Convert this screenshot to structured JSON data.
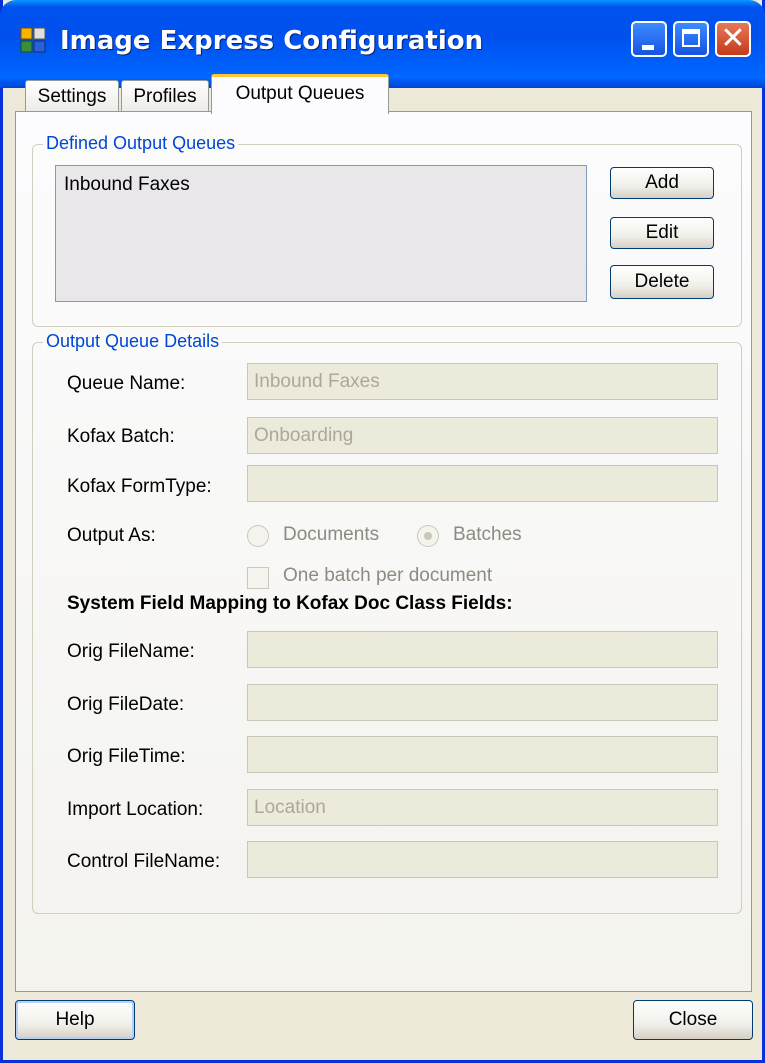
{
  "window": {
    "title": "Image Express Configuration",
    "icon": "app-config-icon"
  },
  "tabs": [
    {
      "label": "Settings",
      "active": false
    },
    {
      "label": "Profiles",
      "active": false
    },
    {
      "label": "Output Queues",
      "active": true
    }
  ],
  "defined_queues": {
    "group_title": "Defined Output Queues",
    "items": [
      "Inbound Faxes"
    ],
    "add_label": "Add",
    "edit_label": "Edit",
    "delete_label": "Delete"
  },
  "details": {
    "group_title": "Output Queue Details",
    "queue_name_label": "Queue Name:",
    "queue_name_value": "Inbound Faxes",
    "kofax_batch_label": "Kofax Batch:",
    "kofax_batch_value": "Onboarding",
    "kofax_formtype_label": "Kofax FormType:",
    "kofax_formtype_value": "",
    "output_as_label": "Output As:",
    "output_as_options": [
      "Documents",
      "Batches"
    ],
    "output_as_selected": "Batches",
    "one_batch_label": "One batch per document",
    "one_batch_checked": false,
    "mapping_heading": "System Field Mapping to Kofax Doc Class Fields:",
    "orig_filename_label": "Orig FileName:",
    "orig_filename_value": "",
    "orig_filedate_label": "Orig FileDate:",
    "orig_filedate_value": "",
    "orig_filetime_label": "Orig FileTime:",
    "orig_filetime_value": "",
    "import_location_label": "Import Location:",
    "import_location_value": "Location",
    "control_filename_label": "Control FileName:",
    "control_filename_value": ""
  },
  "footer": {
    "help_label": "Help",
    "close_label": "Close"
  },
  "colors": {
    "titlebar": "#0054E3",
    "group_title": "#0046D5",
    "window_bg": "#ECE9D8",
    "active_tab_accent": "#FFC83C"
  }
}
